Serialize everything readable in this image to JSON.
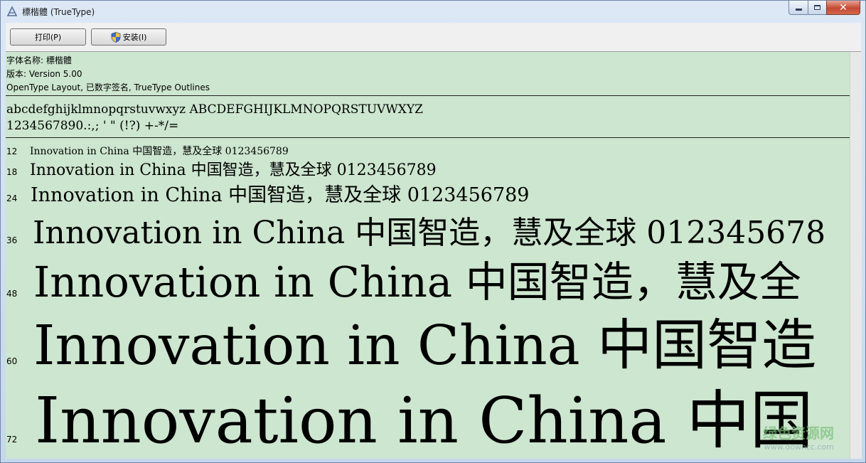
{
  "window": {
    "title": "標楷體 (TrueType)",
    "accent_color": "#cde6cf"
  },
  "toolbar": {
    "print_label": "打印(P)",
    "install_label": "安装(I)"
  },
  "font_info": {
    "name_line": "字体名称: 標楷體",
    "version_line": "版本: Version 5.00",
    "features_line": "OpenType Layout, 已数字签名, TrueType Outlines"
  },
  "charset": {
    "line1": "abcdefghijklmnopqrstuvwxyz ABCDEFGHIJKLMNOPQRSTUVWXYZ",
    "line2": "1234567890.:,; ' \" (!?) +-*/="
  },
  "samples": [
    {
      "size": "12",
      "text": "Innovation in China 中国智造，慧及全球 0123456789"
    },
    {
      "size": "18",
      "text": "Innovation in China 中国智造，慧及全球 0123456789"
    },
    {
      "size": "24",
      "text": "Innovation in China 中国智造，慧及全球 0123456789"
    },
    {
      "size": "36",
      "text": "Innovation in China 中国智造，慧及全球 012345678"
    },
    {
      "size": "48",
      "text": "Innovation in China 中国智造，慧及全"
    },
    {
      "size": "60",
      "text": "Innovation in China 中国智造"
    },
    {
      "size": "72",
      "text": "Innovation in China 中国"
    }
  ],
  "watermark": {
    "main": "绿色资源网",
    "sub": "www.downcc.com"
  },
  "icons": {
    "app": "font-viewer-icon",
    "install": "uac-shield-icon"
  }
}
